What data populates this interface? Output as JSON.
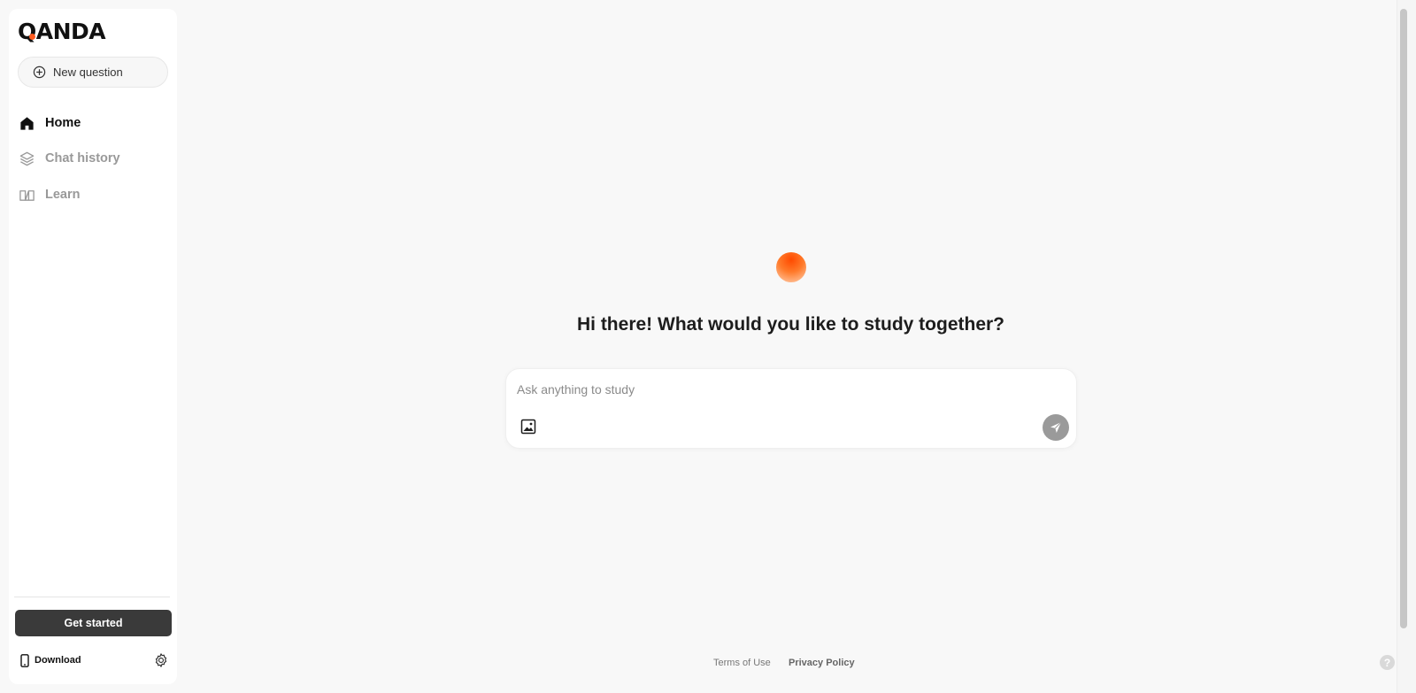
{
  "brand": {
    "logo_text": "QANDA",
    "accent": "#ff5a1f"
  },
  "sidebar": {
    "new_question_label": "New question",
    "items": [
      {
        "label": "Home",
        "icon": "home-icon",
        "active": true
      },
      {
        "label": "Chat history",
        "icon": "layers-icon",
        "active": false
      },
      {
        "label": "Learn",
        "icon": "book-icon",
        "active": false
      }
    ],
    "get_started_label": "Get started",
    "download_label": "Download"
  },
  "main": {
    "greeting": "Hi there! What would you like to study together?",
    "input_placeholder": "Ask anything to study"
  },
  "footer": {
    "terms_label": "Terms of Use",
    "privacy_label": "Privacy Policy"
  },
  "help_label": "?"
}
